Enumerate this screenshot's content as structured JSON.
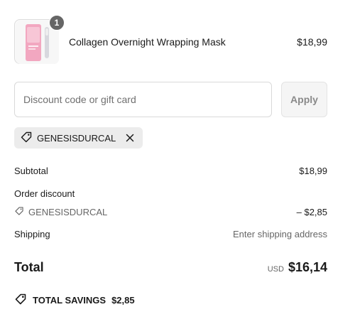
{
  "product": {
    "name": "Collagen Overnight Wrapping Mask",
    "price": "$18,99",
    "quantity": "1",
    "image_icon": "product-thumbnail"
  },
  "discount": {
    "placeholder": "Discount code or gift card",
    "value": "",
    "apply_label": "Apply",
    "applied_code": "GENESISDURCAL"
  },
  "summary": {
    "subtotal_label": "Subtotal",
    "subtotal_value": "$18,99",
    "order_discount_label": "Order discount",
    "discount_code": "GENESISDURCAL",
    "discount_value": "– $2,85",
    "shipping_label": "Shipping",
    "shipping_value": "Enter shipping address",
    "total_label": "Total",
    "currency": "USD",
    "total_value": "$16,14",
    "savings_label": "TOTAL SAVINGS",
    "savings_value": "$2,85"
  },
  "colors": {
    "badge": "#666666",
    "chip_bg": "#ececec",
    "apply_bg": "#f5f5f5",
    "muted_text": "#666666"
  }
}
